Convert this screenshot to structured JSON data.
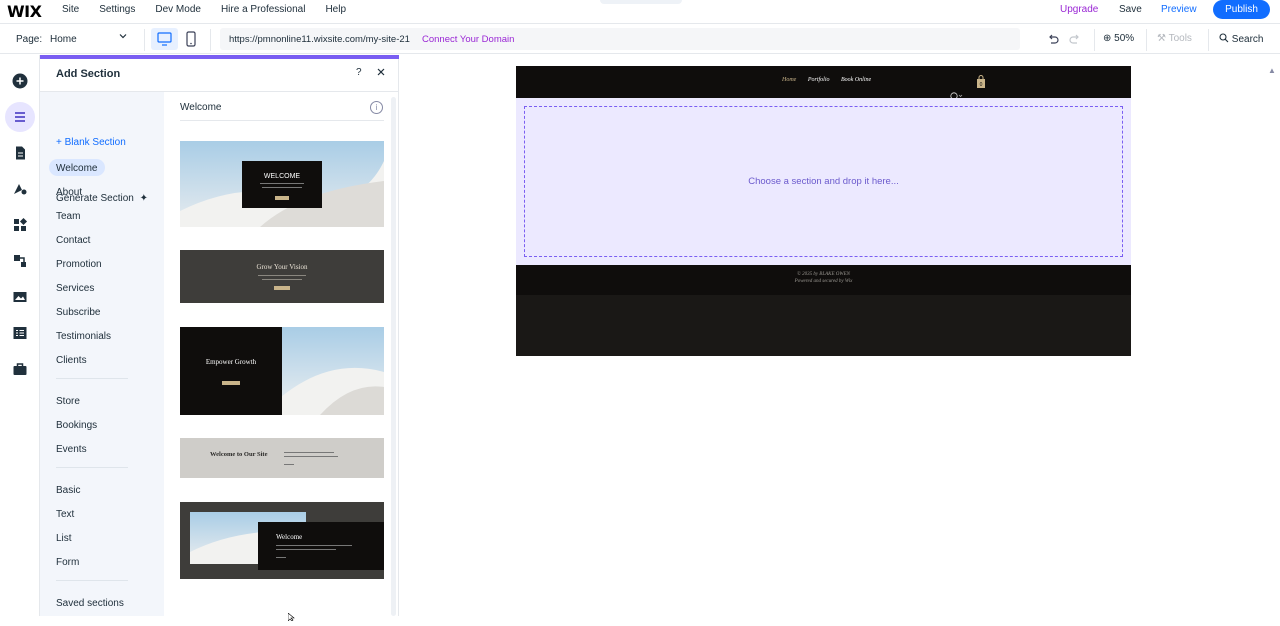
{
  "topbar": {
    "logo": "WIX",
    "menu": [
      "Site",
      "Settings",
      "Dev Mode",
      "Hire a Professional",
      "Help"
    ],
    "upgrade": "Upgrade",
    "save": "Save",
    "preview": "Preview",
    "publish": "Publish"
  },
  "bar2": {
    "page_label": "Page:",
    "page_value": "Home",
    "url": "https://pmnonline11.wixsite.com/my-site-21",
    "connect": "Connect Your Domain",
    "zoom": "50%",
    "tools": "Tools",
    "search": "Search"
  },
  "panel": {
    "title": "Add Section",
    "blank": "Blank Section",
    "generate": "Generate Section",
    "categories_group1": [
      "Welcome",
      "About",
      "Team",
      "Contact",
      "Promotion",
      "Services",
      "Subscribe",
      "Testimonials",
      "Clients"
    ],
    "categories_group2": [
      "Store",
      "Bookings",
      "Events"
    ],
    "categories_group3": [
      "Basic",
      "Text",
      "List",
      "Form"
    ],
    "saved": "Saved sections",
    "list_title": "Welcome",
    "thumbs": {
      "t1_title": "WELCOME",
      "t2_title": "Grow Your Vision",
      "t3_title": "Empower Growth",
      "t4_title": "Welcome to Our Site",
      "t5_title": "Welcome"
    }
  },
  "canvas": {
    "nav": [
      "Home",
      "Portfolio",
      "Book Online"
    ],
    "drop_text": "Choose a section and drop it here...",
    "footer_line1": "© 2035 by BLAKE OWEN",
    "footer_line2": "Powered and secured by Wix"
  },
  "colors": {
    "accent": "#116dff",
    "purple": "#9a27d5",
    "panel_accent": "#7a5ef2"
  }
}
